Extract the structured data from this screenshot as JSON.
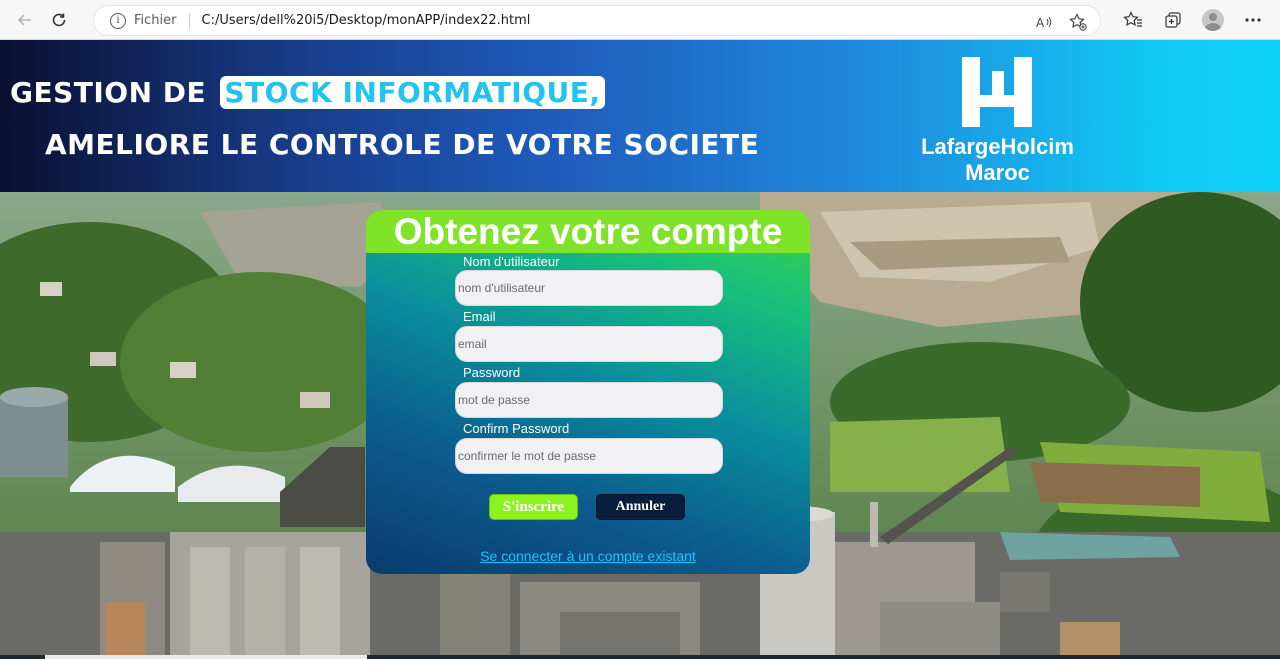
{
  "browser": {
    "back_icon": "arrow-left-icon",
    "reload_icon": "reload-icon",
    "scheme_label": "Fichier",
    "url": "C:/Users/dell%20i5/Desktop/monAPP/index22.html",
    "read_aloud_icon": "read-aloud-icon",
    "add_favorite_icon": "star-plus-icon",
    "favorites_icon": "favorites-icon",
    "collections_icon": "collections-icon",
    "profile_icon": "profile-avatar-icon",
    "menu_icon": "more-dots-icon"
  },
  "header": {
    "line1_prefix": "GESTION DE",
    "line1_highlight": "STOCK INFORMATIQUE,",
    "line2": "AMELIORE LE CONTROLE DE VOTRE SOCIETE",
    "logo_line1": "LafargeHolcim",
    "logo_line2": "Maroc",
    "colors": {
      "gradient_start": "#0b1030",
      "gradient_end": "#0fd3f8",
      "highlight_text": "#20c4ef"
    }
  },
  "form": {
    "title": "Obtenez votre compte",
    "fields": [
      {
        "label": "Nom d'utilisateur",
        "placeholder": "nom d'utilisateur",
        "value": ""
      },
      {
        "label": "Email",
        "placeholder": "email",
        "value": ""
      },
      {
        "label": "Password",
        "placeholder": "mot de passe",
        "value": ""
      },
      {
        "label": "Confirm Password",
        "placeholder": "confirmer le mot de passe",
        "value": ""
      }
    ],
    "submit_label": "S'inscrire",
    "cancel_label": "Annuler",
    "login_link": "Se connecter à un compte existant",
    "colors": {
      "title_bg": "#7fe32a",
      "submit_bg": "#8ef21f",
      "cancel_bg": "#0b1d3d",
      "link": "#1fc3ff"
    }
  }
}
